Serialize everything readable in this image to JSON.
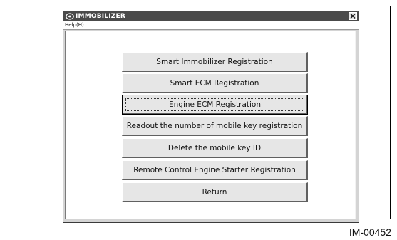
{
  "window": {
    "title": "IMMOBILIZER",
    "close_glyph": "✕",
    "title_icon": "app-disc-icon"
  },
  "menu": {
    "help_label": "Help(H)"
  },
  "buttons": [
    {
      "label": "Smart Immobilizer Registration",
      "focused": false
    },
    {
      "label": "Smart ECM Registration",
      "focused": false
    },
    {
      "label": "Engine ECM Registration",
      "focused": true
    },
    {
      "label": "Readout the number of mobile key registration",
      "focused": false
    },
    {
      "label": "Delete the mobile key ID",
      "focused": false
    },
    {
      "label": "Remote Control Engine Starter Registration",
      "focused": false
    },
    {
      "label": "Return",
      "focused": false
    }
  ],
  "figure_code": "IM-00452"
}
